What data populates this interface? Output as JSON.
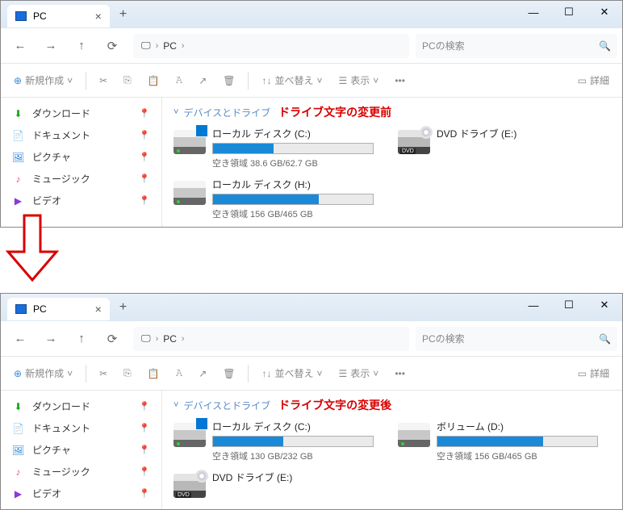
{
  "tab_title": "PC",
  "crumb": "PC",
  "search_placeholder": "PCの検索",
  "toolbar": {
    "new": "新規作成",
    "sort": "並べ替え",
    "view": "表示",
    "details": "詳細"
  },
  "sidebar": [
    {
      "label": "ダウンロード",
      "color": "#1aa81a"
    },
    {
      "label": "ドキュメント",
      "color": "#5a8ac8"
    },
    {
      "label": "ピクチャ",
      "color": "#1a78d8"
    },
    {
      "label": "ミュージック",
      "color": "#e84a8a"
    },
    {
      "label": "ビデオ",
      "color": "#8a3ad8"
    }
  ],
  "section_label": "デバイスとドライブ",
  "annot_before": "ドライブ文字の変更前",
  "annot_after": "ドライブ文字の変更後",
  "before": {
    "d1_name": "ローカル ディスク (C:)",
    "d1_space": "空き領域 38.6 GB/62.7 GB",
    "d1_pct": 38,
    "d2_name": "DVD ドライブ (E:)",
    "d3_name": "ローカル ディスク (H:)",
    "d3_space": "空き領域 156 GB/465 GB",
    "d3_pct": 66
  },
  "after": {
    "d1_name": "ローカル ディスク (C:)",
    "d1_space": "空き領域 130 GB/232 GB",
    "d1_pct": 44,
    "d2_name": "ボリューム (D:)",
    "d2_space": "空き領域 156 GB/465 GB",
    "d2_pct": 66,
    "d3_name": "DVD ドライブ (E:)"
  }
}
